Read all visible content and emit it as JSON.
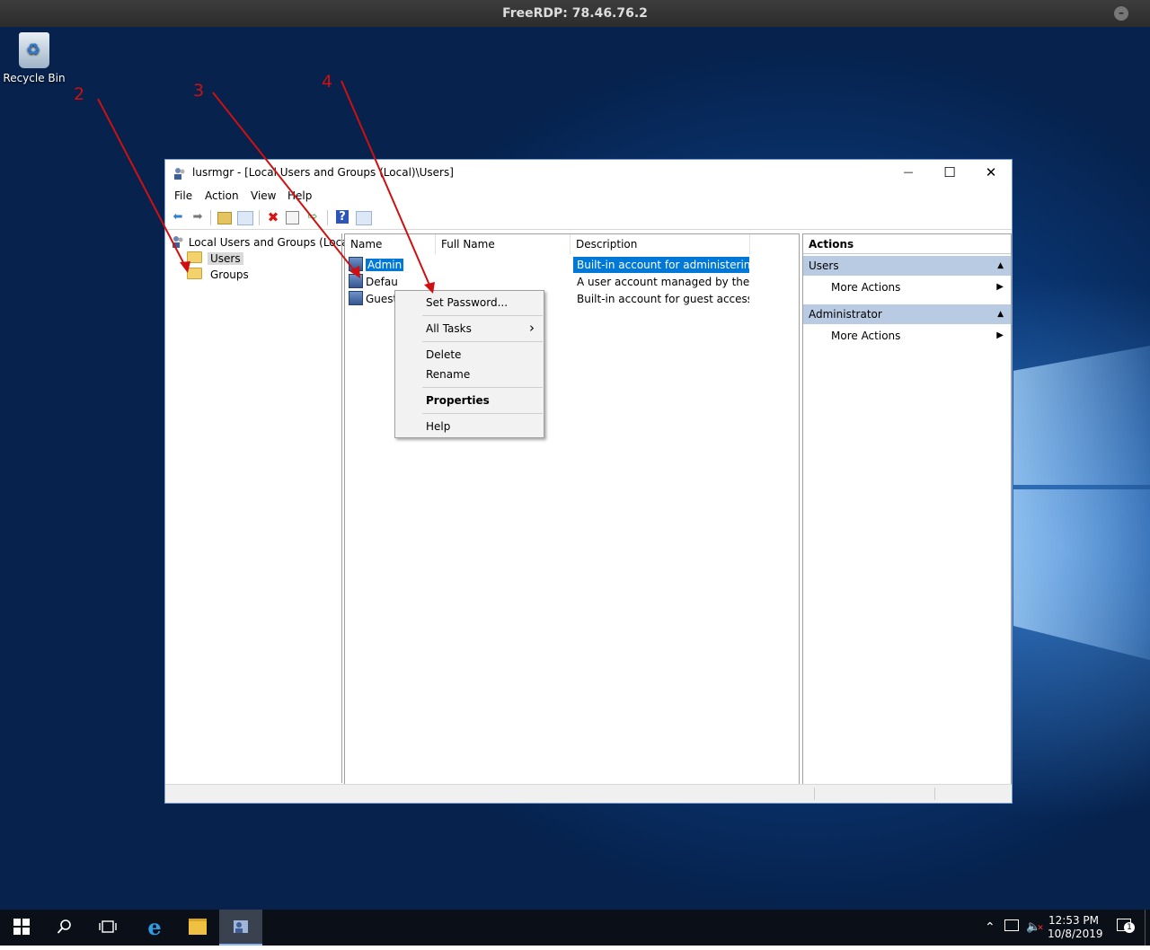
{
  "rdp": {
    "title": "FreeRDP: 78.46.76.2"
  },
  "desktop": {
    "recycle_bin": "Recycle Bin"
  },
  "annotations": [
    "2",
    "3",
    "4"
  ],
  "window": {
    "title": "lusrmgr - [Local Users and Groups (Local)\\Users]",
    "controls": {
      "minimize": "—",
      "maximize": "☐",
      "close": "✕"
    },
    "menu": [
      "File",
      "Action",
      "View",
      "Help"
    ],
    "tree": {
      "root": "Local Users and Groups (Local)",
      "items": [
        "Users",
        "Groups"
      ]
    },
    "list": {
      "columns": [
        "Name",
        "Full Name",
        "Description"
      ],
      "rows": [
        {
          "name": "Administrator",
          "name_visible": "Admin",
          "full_name": "",
          "description": "Built-in account for administering..."
        },
        {
          "name": "DefaultAccount",
          "name_visible": "Defau",
          "full_name": "",
          "description": "A user account managed by the s..."
        },
        {
          "name": "Guest",
          "name_visible": "Guest",
          "full_name": "",
          "description": "Built-in account for guest access t..."
        }
      ]
    },
    "context_menu": {
      "items": [
        "Set Password...",
        "All Tasks",
        "Delete",
        "Rename",
        "Properties",
        "Help"
      ],
      "submenu_arrow": "›"
    },
    "actions": {
      "header": "Actions",
      "sections": [
        {
          "title": "Users",
          "item": "More Actions"
        },
        {
          "title": "Administrator",
          "item": "More Actions"
        }
      ]
    }
  },
  "taskbar": {
    "time": "12:53 PM",
    "date": "10/8/2019",
    "notifications": "1"
  },
  "colors": {
    "selection": "#0078d7",
    "annotation": "#d01010",
    "actions_header": "#b9cbe2"
  }
}
